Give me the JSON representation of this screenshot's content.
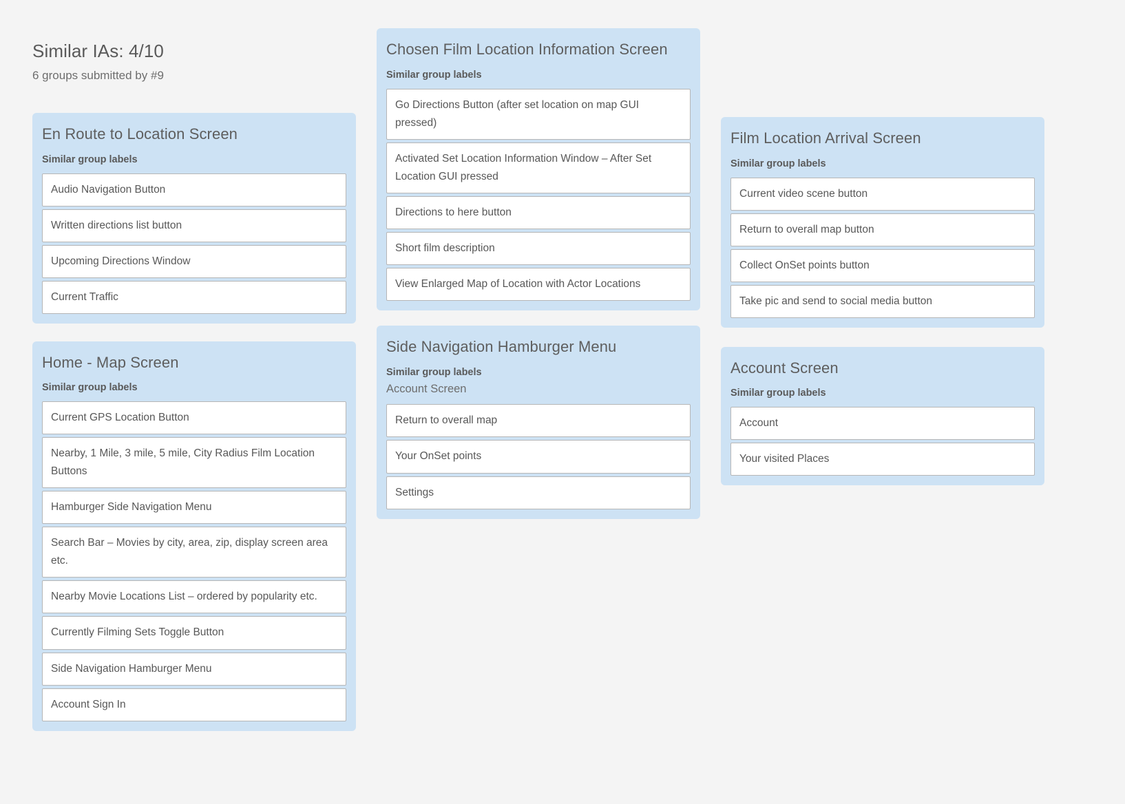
{
  "header": {
    "title": "Similar IAs: 4/10",
    "subtitle": "6 groups submitted by #9"
  },
  "labels": {
    "similar_group_labels": "Similar group labels"
  },
  "colors": {
    "page_background": "#f4f4f4",
    "card_background": "#cde2f4",
    "item_background": "#ffffff",
    "item_border": "#b6b6b6",
    "text": "#585858"
  },
  "columns": [
    {
      "cards": [
        {
          "title": "En Route to Location Screen",
          "subhead": "Similar group labels",
          "subtitle": null,
          "items": [
            "Audio Navigation Button",
            "Written directions list button",
            "Upcoming Directions Window",
            "Current Traffic"
          ]
        },
        {
          "title": "Home - Map Screen",
          "subhead": "Similar group labels",
          "subtitle": null,
          "items": [
            "Current GPS Location Button",
            "Nearby, 1 Mile, 3 mile, 5 mile, City Radius Film Location Buttons",
            "Hamburger Side Navigation Menu",
            "Search Bar – Movies by city, area, zip, display screen area etc.",
            "Nearby Movie Locations List – ordered by popularity etc.",
            "Currently Filming Sets Toggle Button",
            "Side Navigation Hamburger Menu",
            "Account Sign In"
          ]
        }
      ]
    },
    {
      "cards": [
        {
          "title": "Chosen Film Location Information Screen",
          "subhead": "Similar group labels",
          "subtitle": null,
          "items": [
            "Go Directions Button (after set location on map GUI pressed)",
            "Activated Set Location Information Window – After Set Location GUI pressed",
            "Directions to here button",
            "Short film description",
            "View Enlarged Map of Location with Actor Locations"
          ]
        },
        {
          "title": "Side Navigation Hamburger Menu",
          "subhead": "Similar group labels",
          "subtitle": "Account Screen",
          "items": [
            "Return to overall map",
            "Your OnSet points",
            "Settings"
          ]
        }
      ]
    },
    {
      "cards": [
        {
          "title": "Film Location Arrival Screen",
          "subhead": "Similar group labels",
          "subtitle": null,
          "items": [
            "Current video scene button",
            "Return to overall map button",
            "Collect OnSet points button",
            "Take pic and send to social media button"
          ]
        },
        {
          "title": "Account Screen",
          "subhead": "Similar group labels",
          "subtitle": null,
          "items": [
            "Account",
            "Your visited Places"
          ]
        }
      ]
    }
  ]
}
